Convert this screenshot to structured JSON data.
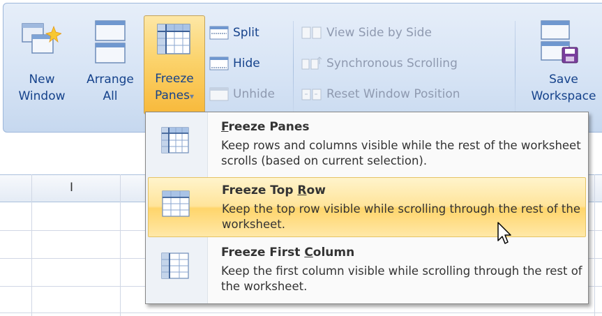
{
  "ribbon": {
    "new_window": {
      "line1": "New",
      "line2": "Window",
      "icon": "new-window-icon"
    },
    "arrange_all": {
      "line1": "Arrange",
      "line2": "All",
      "icon": "arrange-all-icon"
    },
    "freeze_panes": {
      "line1": "Freeze",
      "line2": "Panes",
      "dropdown_glyph": "▾",
      "icon": "freeze-panes-icon"
    },
    "split": {
      "label": "Split",
      "icon": "split-icon"
    },
    "hide": {
      "label": "Hide",
      "icon": "hide-icon"
    },
    "unhide": {
      "label": "Unhide",
      "icon": "unhide-icon",
      "disabled": true
    },
    "view_side_by_side": {
      "label": "View Side by Side",
      "icon": "view-side-by-side-icon",
      "disabled": true
    },
    "synchronous_scrolling": {
      "label": "Synchronous Scrolling",
      "icon": "synchronous-scrolling-icon",
      "disabled": true
    },
    "reset_window_position": {
      "label": "Reset Window Position",
      "icon": "reset-window-position-icon",
      "disabled": true
    },
    "save_workspace": {
      "line1": "Save",
      "line2": "Workspace",
      "icon": "save-workspace-icon"
    }
  },
  "sheet": {
    "column_header_visible": "I"
  },
  "menu": {
    "items": [
      {
        "title_pre": "",
        "title_u": "F",
        "title_post": "reeze Panes",
        "description": "Keep rows and columns visible while the rest of the worksheet scrolls (based on current selection).",
        "icon": "freeze-panes-icon",
        "highlighted": false
      },
      {
        "title_pre": "Freeze Top ",
        "title_u": "R",
        "title_post": "ow",
        "description": "Keep the top row visible while scrolling through the rest of the worksheet.",
        "icon": "freeze-top-row-icon",
        "highlighted": true
      },
      {
        "title_pre": "Freeze First ",
        "title_u": "C",
        "title_post": "olumn",
        "description": "Keep the first column visible while scrolling through the rest of the worksheet.",
        "icon": "freeze-first-column-icon",
        "highlighted": false
      }
    ]
  },
  "colors": {
    "ribbon_text": "#15428b",
    "disabled_text": "#8f9ab0",
    "highlight": "#ffd56b",
    "menu_text": "#333333"
  }
}
